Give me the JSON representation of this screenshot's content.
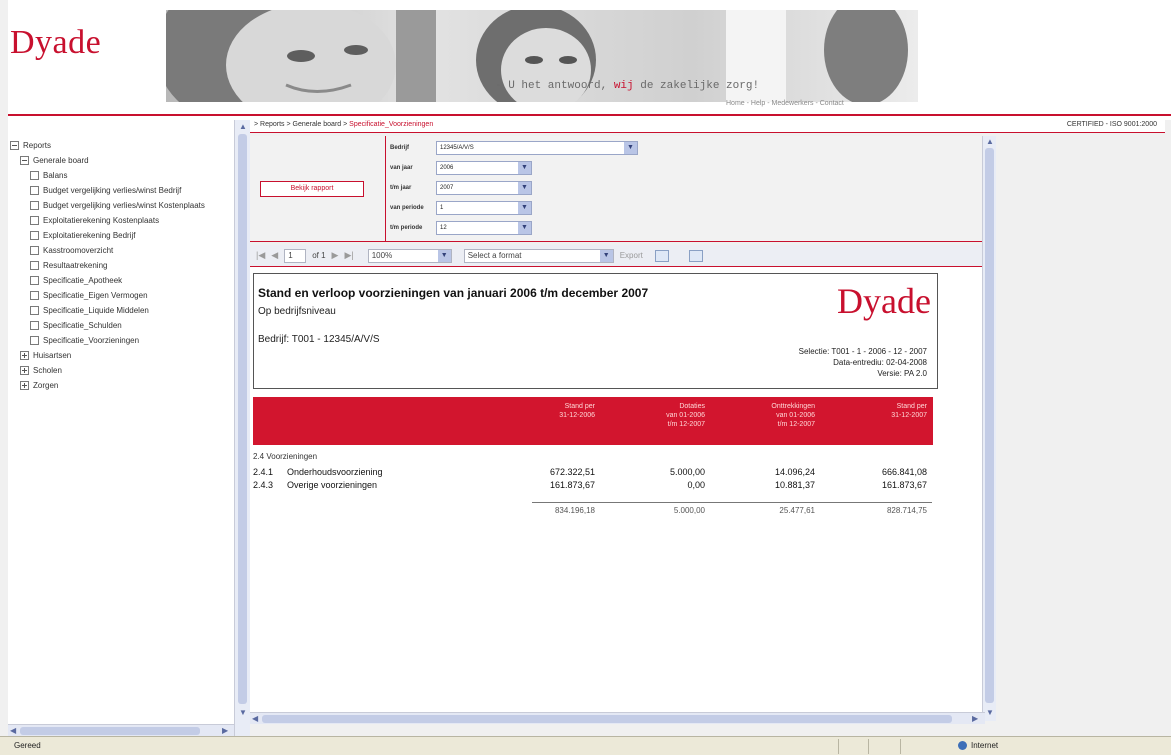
{
  "brand": {
    "logo_text": "Dyade",
    "tagline_prefix": "- U het antwoord, ",
    "tagline_highlight": "wij",
    "tagline_suffix": " de zakelijke zorg!",
    "top_nav": "Home - Help - Medewerkers - Contact",
    "accent_color": "#c8102e"
  },
  "tree": {
    "items": [
      {
        "label": "Reports",
        "level": 1,
        "icon": "minus-box-icon"
      },
      {
        "label": "Generale board",
        "level": 2,
        "icon": "minus-box-icon"
      },
      {
        "label": "Balans",
        "level": 3,
        "icon": "doc-icon"
      },
      {
        "label": "Budget vergelijking verlies/winst Bedrijf",
        "level": 3,
        "icon": "doc-icon"
      },
      {
        "label": "Budget vergelijking verlies/winst Kostenplaats",
        "level": 3,
        "icon": "doc-icon"
      },
      {
        "label": "Exploitatierekening Kostenplaats",
        "level": 3,
        "icon": "doc-icon"
      },
      {
        "label": "Exploitatierekening Bedrijf",
        "level": 3,
        "icon": "doc-icon"
      },
      {
        "label": "Kasstroomoverzicht",
        "level": 3,
        "icon": "doc-icon"
      },
      {
        "label": "Resultaatrekening",
        "level": 3,
        "icon": "doc-icon"
      },
      {
        "label": "Specificatie_Apotheek",
        "level": 3,
        "icon": "doc-icon"
      },
      {
        "label": "Specificatie_Eigen Vermogen",
        "level": 3,
        "icon": "doc-icon"
      },
      {
        "label": "Specificatie_Liquide Middelen",
        "level": 3,
        "icon": "doc-icon"
      },
      {
        "label": "Specificatie_Schulden",
        "level": 3,
        "icon": "doc-icon"
      },
      {
        "label": "Specificatie_Voorzieningen",
        "level": 3,
        "icon": "doc-icon"
      },
      {
        "label": "Huisartsen",
        "level": 2,
        "icon": "plus-box-icon"
      },
      {
        "label": "Scholen",
        "level": 2,
        "icon": "plus-box-icon"
      },
      {
        "label": "Zorgen",
        "level": 2,
        "icon": "plus-box-icon"
      }
    ]
  },
  "breadcrumb": {
    "path": "> Reports > Generale board > ",
    "current": "Specificatie_Voorzieningen",
    "certification": "CERTIFIED - ISO 9001:2000"
  },
  "params": {
    "view_button": "Bekijk rapport",
    "fields": [
      {
        "label": "Bedrijf",
        "value": "12345/A/V/S"
      },
      {
        "label": "van jaar",
        "value": "2006"
      },
      {
        "label": "t/m jaar",
        "value": "2007"
      },
      {
        "label": "van periode",
        "value": "1"
      },
      {
        "label": "t/m periode",
        "value": "12"
      }
    ]
  },
  "toolbar": {
    "page_input": "1",
    "page_of": "of 1",
    "zoom": "100%",
    "format_select": "Select a format",
    "export_label": "Export"
  },
  "report": {
    "title": "Stand en verloop voorzieningen van januari 2006 t/m december 2007",
    "subtitle": "Op bedrijfsniveau",
    "company_line": "Bedrijf: T001 - 12345/A/V/S",
    "logo_text": "Dyade",
    "meta_line1": "Selectie: T001 - 1 - 2006 - 12 - 2007",
    "meta_line2": "Data-entrediu: 02-04-2008",
    "meta_line3": "Versie: PA 2.0",
    "columns": [
      "Stand per\n31-12-2006",
      "Dotaties\nvan 01-2006\nt/m 12-2007",
      "Onttrekkingen\nvan 01-2006\nt/m 12-2007",
      "Stand per\n31-12-2007"
    ],
    "section_label": "2.4 Voorzieningen",
    "rows": [
      {
        "code": "2.4.1",
        "name": "Onderhoudsvoorziening",
        "v1": "672.322,51",
        "v2": "5.000,00",
        "v3": "14.096,24",
        "v4": "666.841,08"
      },
      {
        "code": "2.4.3",
        "name": "Overige voorzieningen",
        "v1": "161.873,67",
        "v2": "0,00",
        "v3": "10.881,37",
        "v4": "161.873,67"
      }
    ],
    "totals": {
      "v1": "834.196,18",
      "v2": "5.000,00",
      "v3": "25.477,61",
      "v4": "828.714,75"
    }
  },
  "status": {
    "left_text": "Gereed",
    "zone_text": "Internet"
  }
}
